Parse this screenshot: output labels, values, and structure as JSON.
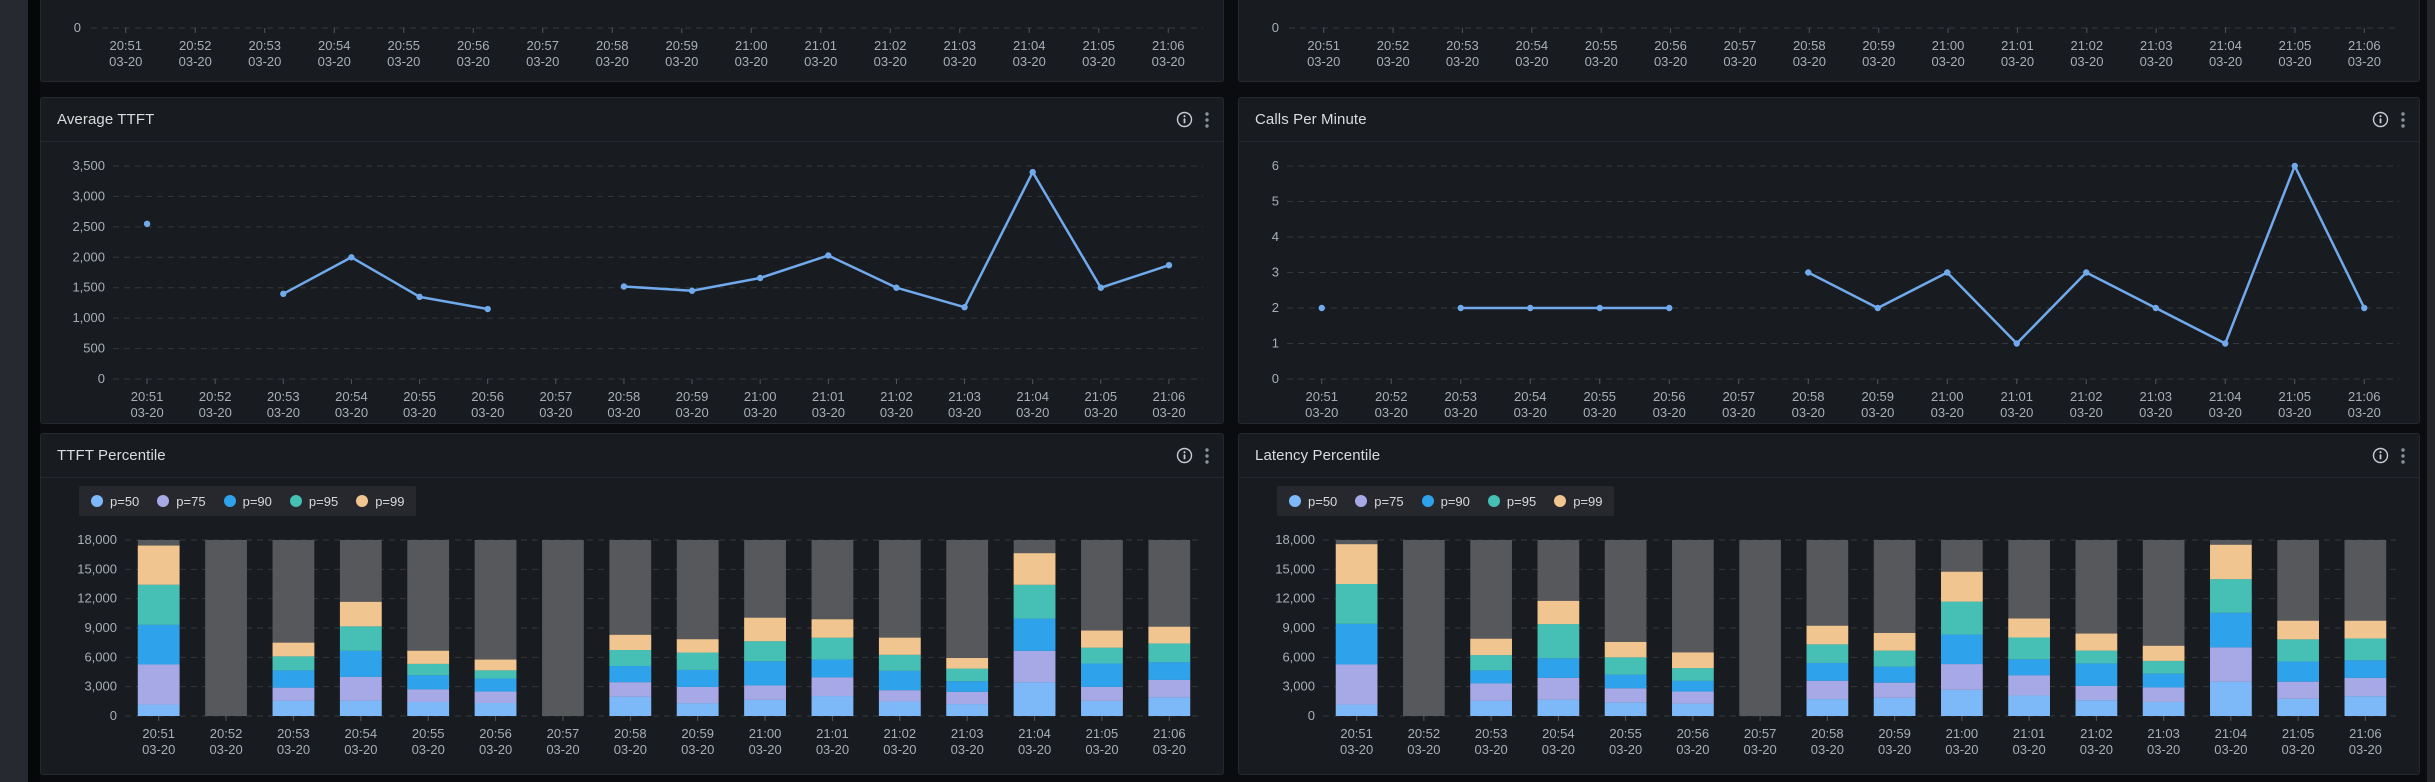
{
  "theme": {
    "page_bg": "#0B0C0F",
    "panel_bg": "#181B1F",
    "panel_border": "#25282E",
    "title_color": "#DBDCDE",
    "axis_text_color": "#A9AEB7",
    "gridline_color": "rgba(204,204,220,0.16)",
    "tick_color": "rgba(204,204,220,0.32)",
    "line_color": "#70A9EC",
    "bar_backdrop_color": "#57585B",
    "legend_bg": "#26282D",
    "legend_text": "#D8D9DA",
    "icon_color": "#C9CCD2",
    "series_colors": {
      "p50": "#7DB8F9",
      "p75": "#A6A9E5",
      "p90": "#2FA2EC",
      "p95": "#46BFB5",
      "p99": "#F1C58F"
    }
  },
  "x_axis": {
    "times": [
      "20:51",
      "20:52",
      "20:53",
      "20:54",
      "20:55",
      "20:56",
      "20:57",
      "20:58",
      "20:59",
      "21:00",
      "21:01",
      "21:02",
      "21:03",
      "21:04",
      "21:05",
      "21:06"
    ],
    "date": "03-20"
  },
  "panel_actions": {
    "info_icon": "ⓘ",
    "menu_icon": "⋮"
  },
  "panels": [
    {
      "title": "",
      "kind": "axis_only",
      "visible_tick_label": "0"
    },
    {
      "title": "",
      "kind": "axis_only",
      "visible_tick_label": "0"
    },
    {
      "title": "Average TTFT",
      "kind": "line",
      "chart_index": 0
    },
    {
      "title": "Calls Per Minute",
      "kind": "line",
      "chart_index": 1
    },
    {
      "title": "TTFT Percentile",
      "kind": "stacked_bars",
      "chart_index": 2
    },
    {
      "title": "Latency Percentile",
      "kind": "stacked_bars",
      "chart_index": 3
    }
  ],
  "chart_data": [
    {
      "type": "line",
      "title": "Average TTFT",
      "categories": [
        "20:51",
        "20:52",
        "20:53",
        "20:54",
        "20:55",
        "20:56",
        "20:57",
        "20:58",
        "20:59",
        "21:00",
        "21:01",
        "21:02",
        "21:03",
        "21:04",
        "21:05",
        "21:06"
      ],
      "category_date": "03-20",
      "values": [
        2550,
        null,
        1400,
        2000,
        1350,
        1150,
        null,
        1520,
        1450,
        1660,
        2030,
        1500,
        1180,
        3400,
        1500,
        1870
      ],
      "ylim": [
        0,
        3500
      ],
      "ytick_step": 500,
      "grid": true,
      "color": "#70A9EC"
    },
    {
      "type": "line",
      "title": "Calls Per Minute",
      "categories": [
        "20:51",
        "20:52",
        "20:53",
        "20:54",
        "20:55",
        "20:56",
        "20:57",
        "20:58",
        "20:59",
        "21:00",
        "21:01",
        "21:02",
        "21:03",
        "21:04",
        "21:05",
        "21:06"
      ],
      "category_date": "03-20",
      "values": [
        2,
        null,
        2,
        2,
        2,
        2,
        null,
        3,
        2,
        3,
        1,
        3,
        2,
        1,
        6,
        2
      ],
      "ylim": [
        0,
        6
      ],
      "ytick_step": 1,
      "grid": true,
      "color": "#70A9EC"
    },
    {
      "type": "bar",
      "stacked": true,
      "title": "TTFT Percentile",
      "categories": [
        "20:51",
        "20:52",
        "20:53",
        "20:54",
        "20:55",
        "20:56",
        "20:57",
        "20:58",
        "20:59",
        "21:00",
        "21:01",
        "21:02",
        "21:03",
        "21:04",
        "21:05",
        "21:06"
      ],
      "category_date": "03-20",
      "ylim": [
        0,
        18000
      ],
      "ytick_step": 3000,
      "grid": true,
      "legend_position": "top-left",
      "backdrop_bar": {
        "color": "#57585B",
        "extends_to": 18000
      },
      "series": [
        {
          "name": "p=50",
          "color": "#7DB8F9",
          "cumulative_values": [
            1170,
            null,
            1570,
            1570,
            1430,
            1330,
            null,
            1980,
            1320,
            1650,
            2040,
            1480,
            1220,
            3460,
            1550,
            1910
          ]
        },
        {
          "name": "p=75",
          "color": "#A6A9E5",
          "cumulative_values": [
            5270,
            null,
            2900,
            4000,
            2730,
            2500,
            null,
            3460,
            2970,
            3130,
            3960,
            2640,
            2470,
            6660,
            2970,
            3690
          ]
        },
        {
          "name": "p=90",
          "color": "#2FA2EC",
          "cumulative_values": [
            9330,
            null,
            4670,
            6670,
            4170,
            3830,
            null,
            5110,
            4710,
            5600,
            5770,
            4620,
            3560,
            9960,
            5370,
            5510
          ]
        },
        {
          "name": "p=95",
          "color": "#46BFB5",
          "cumulative_values": [
            13430,
            null,
            6100,
            9170,
            5330,
            4670,
            null,
            6750,
            6490,
            7650,
            8010,
            6260,
            4850,
            13420,
            6990,
            7420
          ]
        },
        {
          "name": "p=99",
          "color": "#F1C58F",
          "cumulative_values": [
            17430,
            null,
            7500,
            11670,
            6670,
            5770,
            null,
            8300,
            7850,
            10050,
            9890,
            8010,
            5930,
            16650,
            8740,
            9130
          ]
        }
      ]
    },
    {
      "type": "bar",
      "stacked": true,
      "title": "Latency Percentile",
      "categories": [
        "20:51",
        "20:52",
        "20:53",
        "20:54",
        "20:55",
        "20:56",
        "20:57",
        "20:58",
        "20:59",
        "21:00",
        "21:01",
        "21:02",
        "21:03",
        "21:04",
        "21:05",
        "21:06"
      ],
      "category_date": "03-20",
      "ylim": [
        0,
        18000
      ],
      "ytick_step": 3000,
      "grid": true,
      "legend_position": "top-left",
      "backdrop_bar": {
        "color": "#57585B",
        "extends_to": 18000
      },
      "series": [
        {
          "name": "p=50",
          "color": "#7DB8F9",
          "cumulative_values": [
            1170,
            null,
            1570,
            1670,
            1400,
            1270,
            null,
            1730,
            1870,
            2690,
            2100,
            1610,
            1440,
            3510,
            1770,
            2030
          ]
        },
        {
          "name": "p=75",
          "color": "#A6A9E5",
          "cumulative_values": [
            5270,
            null,
            3330,
            3900,
            2830,
            2500,
            null,
            3600,
            3410,
            5310,
            4160,
            3080,
            2920,
            7020,
            3510,
            3900
          ]
        },
        {
          "name": "p=90",
          "color": "#2FA2EC",
          "cumulative_values": [
            9430,
            null,
            4670,
            5900,
            4230,
            3600,
            null,
            5430,
            5050,
            8330,
            5800,
            5380,
            4330,
            10560,
            5570,
            5700
          ]
        },
        {
          "name": "p=95",
          "color": "#46BFB5",
          "cumulative_values": [
            13500,
            null,
            6230,
            9400,
            6000,
            4900,
            null,
            7330,
            6690,
            11700,
            8030,
            6690,
            5640,
            14000,
            7840,
            7930
          ]
        },
        {
          "name": "p=99",
          "color": "#F1C58F",
          "cumulative_values": [
            17570,
            null,
            7900,
            11770,
            7570,
            6500,
            null,
            9230,
            8490,
            14750,
            9970,
            8430,
            7180,
            17510,
            9740,
            9740
          ]
        }
      ]
    }
  ]
}
